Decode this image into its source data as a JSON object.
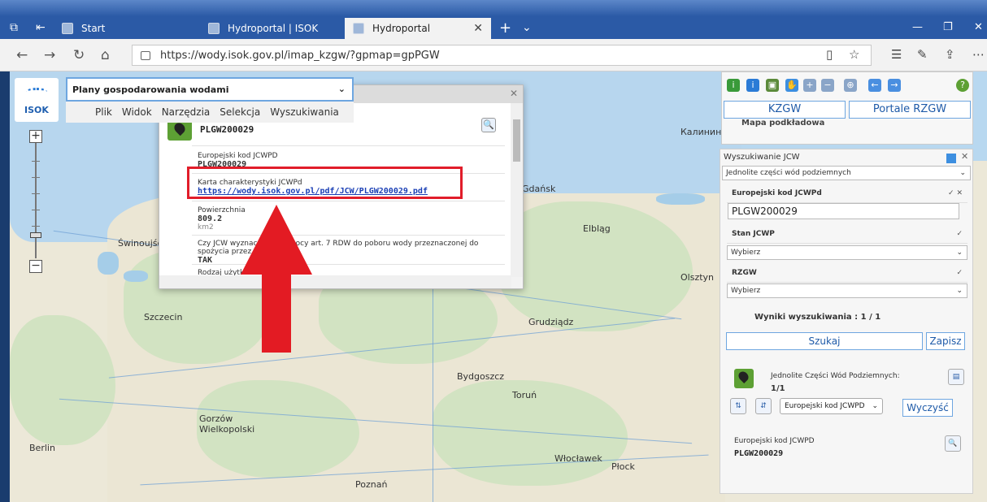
{
  "browser": {
    "tabs": [
      {
        "label": "Start"
      },
      {
        "label": "Hydroportal | ISOK"
      },
      {
        "label": "Hydroportal"
      }
    ],
    "url": "https://wody.isok.gov.pl/imap_kzgw/?gpmap=gpPGW"
  },
  "app": {
    "logo_text": "ISOK",
    "layer_select": "Plany gospodarowania wodami",
    "menu": [
      "Plik",
      "Widok",
      "Narzędzia",
      "Selekcja",
      "Wyszukiwania"
    ]
  },
  "popup": {
    "title": "PLGW200029",
    "fields": [
      {
        "label": "Europejski kod JCWPD",
        "value": "PLGW200029"
      },
      {
        "label": "Karta charakterystyki JCWPd",
        "value": "https://wody.isok.gov.pl/pdf/JCW/PLGW200029.pdf"
      },
      {
        "label": "Powierzchnia",
        "value": "809.2",
        "unit": "km2"
      },
      {
        "label": "Czy JCW wyznaczona na mocy art. 7 RDW do poboru wody przeznaczonej do",
        "label2": "spożycia przez ludzi",
        "value": "TAK"
      },
      {
        "label": "Rodzaj użytk"
      }
    ]
  },
  "map": {
    "cities": [
      "Калининград",
      "Gdańsk",
      "Elbląg",
      "Świnoujście",
      "Olsztyn",
      "Szczecin",
      "Grudziądz",
      "Bydgoszcz",
      "Toruń",
      "Gorzów Wielkopolski",
      "Berlin",
      "Włocławek",
      "Płock",
      "Poznań"
    ]
  },
  "right_panel": {
    "kzgw": "KZGW",
    "portale": "Portale RZGW",
    "layer": "Mapa podkładowa",
    "title": "Wyszukiwanie JCW",
    "type_select": "Jednolite części wód podziemnych",
    "code_label": "Europejski kod JCWPd",
    "code_value": "PLGW200029",
    "state_label": "Stan JCWP",
    "state_select": "Wybierz",
    "rzgw_label": "RZGW",
    "rzgw_select": "Wybierz",
    "results": "Wyniki wyszukiwania : 1 / 1",
    "search_btn": "Szukaj",
    "save_btn": "Zapisz",
    "result_title": "Jednolite Części Wód Podziemnych:",
    "result_count": "1/1",
    "sort_select": "Europejski kod JCWPD",
    "clear_btn": "Wyczyść",
    "result_field_label": "Europejski kod JCWPD",
    "result_field_value": "PLGW200029"
  }
}
